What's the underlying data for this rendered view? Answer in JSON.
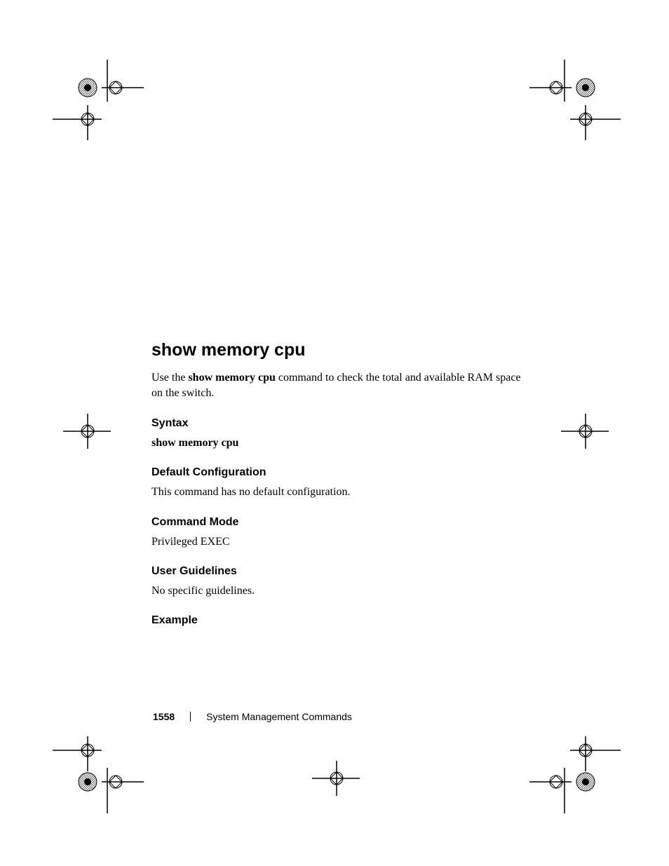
{
  "title": "show memory cpu",
  "intro_prefix": "Use the ",
  "intro_bold": "show memory cpu",
  "intro_suffix": " command to check the total and available RAM space on the switch.",
  "syntax": {
    "heading": "Syntax",
    "text": "show memory cpu"
  },
  "default_config": {
    "heading": "Default Configuration",
    "text": "This command has no default configuration."
  },
  "command_mode": {
    "heading": "Command Mode",
    "text": "Privileged EXEC"
  },
  "user_guidelines": {
    "heading": "User Guidelines",
    "text": "No specific guidelines."
  },
  "example": {
    "heading": "Example"
  },
  "footer": {
    "page_number": "1558",
    "chapter": "System Management Commands"
  }
}
